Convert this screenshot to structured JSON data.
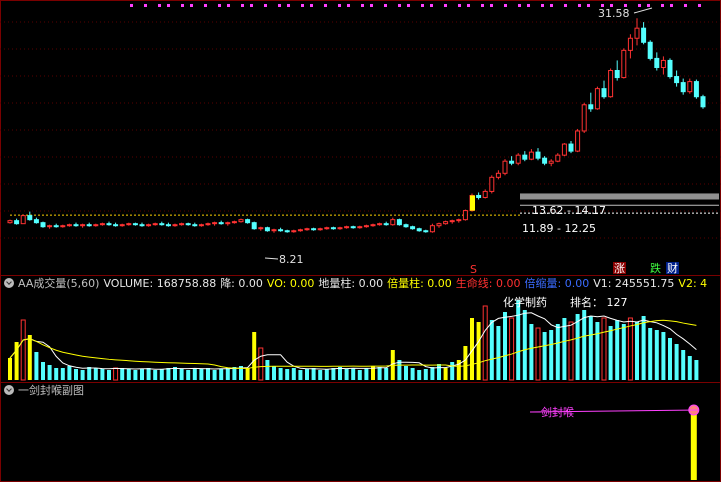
{
  "chart_data": [
    {
      "type": "candlestick",
      "price_labels": {
        "high": "31.58",
        "low": "8.21",
        "band_upper": "13.62 - 14.17",
        "band_lower": "11.89 - 12.25"
      },
      "signal_labels": {
        "s": "S",
        "zhang": "涨",
        "die": "跌",
        "cai": "财"
      },
      "ylim": [
        7,
        33
      ],
      "candles": [
        [
          11.3,
          11.6,
          11.2,
          11.5
        ],
        [
          11.5,
          11.7,
          11.1,
          11.2
        ],
        [
          11.2,
          12.1,
          11.2,
          12.0
        ],
        [
          12.0,
          12.4,
          11.5,
          11.6
        ],
        [
          11.6,
          11.8,
          11.2,
          11.3
        ],
        [
          11.3,
          11.4,
          10.8,
          10.9
        ],
        [
          10.9,
          11.1,
          10.7,
          11.0
        ],
        [
          11.0,
          11.2,
          10.8,
          10.9
        ],
        [
          10.9,
          11.1,
          10.8,
          11.0
        ],
        [
          11.0,
          11.2,
          10.9,
          11.1
        ],
        [
          11.1,
          11.3,
          10.9,
          11.0
        ],
        [
          11.0,
          11.2,
          10.8,
          11.1
        ],
        [
          11.1,
          11.3,
          10.9,
          11.0
        ],
        [
          11.0,
          11.2,
          10.9,
          11.1
        ],
        [
          11.1,
          11.3,
          11.0,
          11.2
        ],
        [
          11.2,
          11.4,
          11.0,
          11.1
        ],
        [
          11.1,
          11.3,
          10.9,
          11.0
        ],
        [
          11.0,
          11.2,
          10.9,
          11.1
        ],
        [
          11.1,
          11.3,
          11.0,
          11.2
        ],
        [
          11.2,
          11.3,
          11.0,
          11.1
        ],
        [
          11.1,
          11.3,
          10.9,
          11.0
        ],
        [
          11.0,
          11.2,
          10.9,
          11.1
        ],
        [
          11.1,
          11.3,
          11.0,
          11.2
        ],
        [
          11.2,
          11.4,
          11.0,
          11.1
        ],
        [
          11.1,
          11.3,
          10.9,
          11.0
        ],
        [
          11.0,
          11.2,
          10.9,
          11.1
        ],
        [
          11.1,
          11.3,
          11.0,
          11.2
        ],
        [
          11.2,
          11.3,
          11.0,
          11.1
        ],
        [
          11.1,
          11.3,
          10.9,
          11.0
        ],
        [
          11.0,
          11.2,
          10.9,
          11.1
        ],
        [
          11.1,
          11.3,
          11.0,
          11.2
        ],
        [
          11.2,
          11.4,
          11.0,
          11.3
        ],
        [
          11.3,
          11.5,
          11.1,
          11.2
        ],
        [
          11.2,
          11.4,
          11.0,
          11.3
        ],
        [
          11.3,
          11.5,
          11.2,
          11.4
        ],
        [
          11.4,
          11.7,
          11.3,
          11.6
        ],
        [
          11.6,
          11.7,
          11.2,
          11.3
        ],
        [
          11.3,
          11.4,
          10.6,
          10.7
        ],
        [
          10.7,
          10.9,
          10.5,
          10.8
        ],
        [
          10.8,
          10.9,
          10.4,
          10.5
        ],
        [
          10.5,
          10.7,
          10.3,
          10.6
        ],
        [
          10.6,
          10.8,
          10.4,
          10.5
        ],
        [
          10.5,
          10.6,
          10.3,
          10.4
        ],
        [
          10.4,
          10.6,
          10.3,
          10.5
        ],
        [
          10.5,
          10.7,
          10.4,
          10.6
        ],
        [
          10.6,
          10.8,
          10.5,
          10.7
        ],
        [
          10.7,
          10.8,
          10.5,
          10.6
        ],
        [
          10.6,
          10.8,
          10.5,
          10.7
        ],
        [
          10.7,
          10.9,
          10.6,
          10.8
        ],
        [
          10.8,
          10.9,
          10.6,
          10.7
        ],
        [
          10.7,
          10.9,
          10.6,
          10.8
        ],
        [
          10.8,
          11.0,
          10.7,
          10.9
        ],
        [
          10.9,
          11.0,
          10.7,
          10.8
        ],
        [
          10.8,
          11.0,
          10.7,
          10.9
        ],
        [
          10.9,
          11.1,
          10.8,
          11.0
        ],
        [
          11.0,
          11.2,
          10.9,
          11.1
        ],
        [
          11.1,
          11.3,
          11.0,
          11.2
        ],
        [
          11.2,
          11.4,
          11.0,
          11.1
        ],
        [
          11.1,
          11.8,
          11.0,
          11.6
        ],
        [
          11.6,
          11.7,
          11.0,
          11.1
        ],
        [
          11.1,
          11.2,
          10.8,
          10.9
        ],
        [
          10.9,
          11.0,
          10.6,
          10.7
        ],
        [
          10.7,
          10.8,
          10.4,
          10.5
        ],
        [
          10.5,
          10.6,
          10.3,
          10.4
        ],
        [
          10.4,
          11.2,
          10.3,
          11.0
        ],
        [
          11.0,
          11.3,
          10.8,
          11.2
        ],
        [
          11.2,
          11.5,
          11.1,
          11.4
        ],
        [
          11.4,
          11.6,
          11.2,
          11.5
        ],
        [
          11.5,
          11.7,
          11.3,
          11.6
        ],
        [
          11.6,
          12.6,
          11.5,
          12.5
        ],
        [
          12.5,
          14.2,
          12.4,
          14.0
        ],
        [
          14.0,
          14.3,
          13.6,
          13.8
        ],
        [
          13.8,
          14.6,
          13.7,
          14.4
        ],
        [
          14.4,
          16.0,
          14.2,
          15.8
        ],
        [
          15.8,
          16.5,
          15.6,
          16.2
        ],
        [
          16.2,
          17.6,
          16.0,
          17.4
        ],
        [
          17.4,
          17.9,
          17.0,
          17.2
        ],
        [
          17.2,
          18.2,
          17.0,
          18.0
        ],
        [
          18.0,
          18.4,
          17.4,
          17.6
        ],
        [
          17.6,
          18.6,
          17.5,
          18.3
        ],
        [
          18.3,
          18.7,
          17.5,
          17.7
        ],
        [
          17.7,
          17.9,
          17.0,
          17.2
        ],
        [
          17.2,
          17.6,
          16.9,
          17.4
        ],
        [
          17.4,
          18.2,
          17.3,
          18.0
        ],
        [
          18.0,
          19.2,
          17.9,
          19.1
        ],
        [
          19.1,
          19.4,
          18.2,
          18.4
        ],
        [
          18.4,
          20.6,
          18.3,
          20.4
        ],
        [
          20.4,
          23.2,
          20.2,
          23.0
        ],
        [
          23.0,
          24.2,
          22.3,
          22.6
        ],
        [
          22.6,
          24.8,
          22.5,
          24.6
        ],
        [
          24.6,
          25.4,
          23.6,
          23.8
        ],
        [
          23.8,
          26.6,
          23.7,
          26.4
        ],
        [
          26.4,
          27.4,
          25.4,
          25.7
        ],
        [
          25.7,
          28.6,
          25.6,
          28.4
        ],
        [
          28.4,
          30.0,
          27.6,
          29.6
        ],
        [
          29.6,
          31.58,
          28.9,
          30.6
        ],
        [
          30.6,
          31.2,
          29.0,
          29.2
        ],
        [
          29.2,
          29.4,
          27.4,
          27.6
        ],
        [
          27.6,
          28.2,
          26.4,
          26.7
        ],
        [
          26.7,
          27.8,
          26.0,
          27.4
        ],
        [
          27.4,
          27.6,
          25.6,
          25.8
        ],
        [
          25.8,
          26.4,
          24.8,
          25.2
        ],
        [
          25.2,
          25.6,
          24.0,
          24.3
        ],
        [
          24.3,
          25.6,
          24.1,
          25.3
        ],
        [
          25.3,
          25.5,
          23.6,
          23.8
        ],
        [
          23.8,
          24.0,
          22.6,
          22.8
        ]
      ]
    },
    {
      "type": "bar",
      "title": "AA成交量(5,60)",
      "volumes": [
        22,
        38,
        60,
        45,
        28,
        18,
        15,
        12,
        12,
        14,
        11,
        10,
        13,
        12,
        11,
        10,
        12,
        12,
        11,
        10,
        11,
        12,
        10,
        11,
        12,
        13,
        11,
        10,
        12,
        11,
        12,
        10,
        11,
        12,
        13,
        14,
        12,
        48,
        32,
        20,
        14,
        12,
        11,
        12,
        10,
        11,
        12,
        10,
        11,
        12,
        13,
        11,
        12,
        10,
        12,
        14,
        13,
        12,
        30,
        20,
        14,
        12,
        10,
        11,
        13,
        16,
        12,
        18,
        20,
        34,
        62,
        58,
        74,
        60,
        54,
        68,
        62,
        80,
        70,
        56,
        52,
        48,
        50,
        56,
        62,
        58,
        66,
        70,
        64,
        58,
        62,
        54,
        60,
        56,
        62,
        58,
        64,
        52,
        50,
        48,
        42,
        36,
        30,
        24,
        20
      ],
      "vol_colors": [
        "y",
        "y",
        "r",
        "y",
        "c",
        "c",
        "c",
        "c",
        "c",
        "c",
        "c",
        "c",
        "c",
        "c",
        "c",
        "c",
        "r",
        "c",
        "c",
        "c",
        "c",
        "c",
        "c",
        "c",
        "c",
        "c",
        "c",
        "c",
        "c",
        "c",
        "c",
        "c",
        "c",
        "c",
        "c",
        "c",
        "y",
        "y",
        "r",
        "c",
        "c",
        "c",
        "c",
        "c",
        "c",
        "c",
        "c",
        "c",
        "c",
        "c",
        "c",
        "c",
        "c",
        "c",
        "c",
        "y",
        "c",
        "c",
        "y",
        "c",
        "c",
        "c",
        "c",
        "c",
        "c",
        "c",
        "y",
        "c",
        "y",
        "y",
        "y",
        "y",
        "r",
        "c",
        "c",
        "c",
        "r",
        "c",
        "c",
        "c",
        "r",
        "c",
        "c",
        "c",
        "c",
        "r",
        "c",
        "c",
        "c",
        "c",
        "r",
        "c",
        "c",
        "c",
        "r",
        "c",
        "c",
        "c",
        "c",
        "c",
        "c",
        "c",
        "c",
        "c",
        "c"
      ],
      "volume_ylim": [
        0,
        100
      ],
      "legend": [
        {
          "label": "AA成交量(5,60)",
          "color": "#c0c0c0"
        },
        {
          "label": "VOLUME: 168758.88",
          "color": "#e8e8e8"
        },
        {
          "label": "降: 0.00",
          "color": "#e8e8e8"
        },
        {
          "label": "VO: 0.00",
          "color": "#ffff00"
        },
        {
          "label": "地量柱: 0.00",
          "color": "#e8e8e8"
        },
        {
          "label": "倍量柱: 0.00",
          "color": "#ffff00"
        },
        {
          "label": "生命线: 0.00",
          "color": "#ff3030"
        },
        {
          "label": "倍缩量: 0.00",
          "color": "#3a6bff"
        },
        {
          "label": "V1: 245551.75",
          "color": "#e8e8e8"
        },
        {
          "label": "V2: 4",
          "color": "#ffff00"
        }
      ],
      "annotations": {
        "text": "化学制药",
        "rank": "排名： 127"
      }
    },
    {
      "type": "signal",
      "title": "一剑封喉副图",
      "marker_label": "一剑封喉",
      "signal_index": 103
    }
  ]
}
